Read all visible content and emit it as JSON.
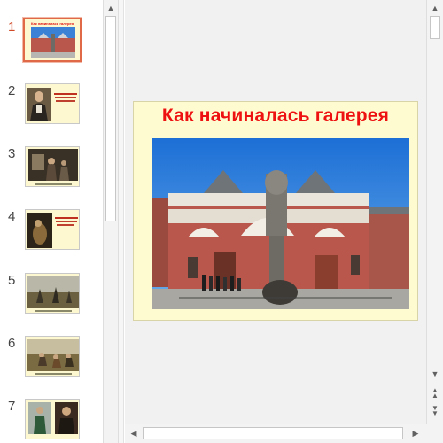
{
  "slides": [
    {
      "number": "1",
      "active": true,
      "caption": "Как начиналась галерея"
    },
    {
      "number": "2",
      "active": false,
      "caption": ""
    },
    {
      "number": "3",
      "active": false,
      "caption": ""
    },
    {
      "number": "4",
      "active": false,
      "caption": ""
    },
    {
      "number": "5",
      "active": false,
      "caption": ""
    },
    {
      "number": "6",
      "active": false,
      "caption": ""
    },
    {
      "number": "7",
      "active": false,
      "caption": ""
    }
  ],
  "current_slide": {
    "title": "Как начиналась галерея",
    "image": "tretyakov-gallery-facade-photo"
  },
  "icons": {
    "scroll_up": "arrow-up-icon",
    "scroll_down": "arrow-down-icon",
    "scroll_left": "arrow-left-icon",
    "scroll_right": "arrow-right-icon",
    "previous_slide": "double-arrow-up-icon",
    "next_slide": "double-arrow-down-icon"
  },
  "colors": {
    "accent": "#e06a48",
    "title_red": "#ee1111",
    "slide_background": "#fefbd0"
  }
}
